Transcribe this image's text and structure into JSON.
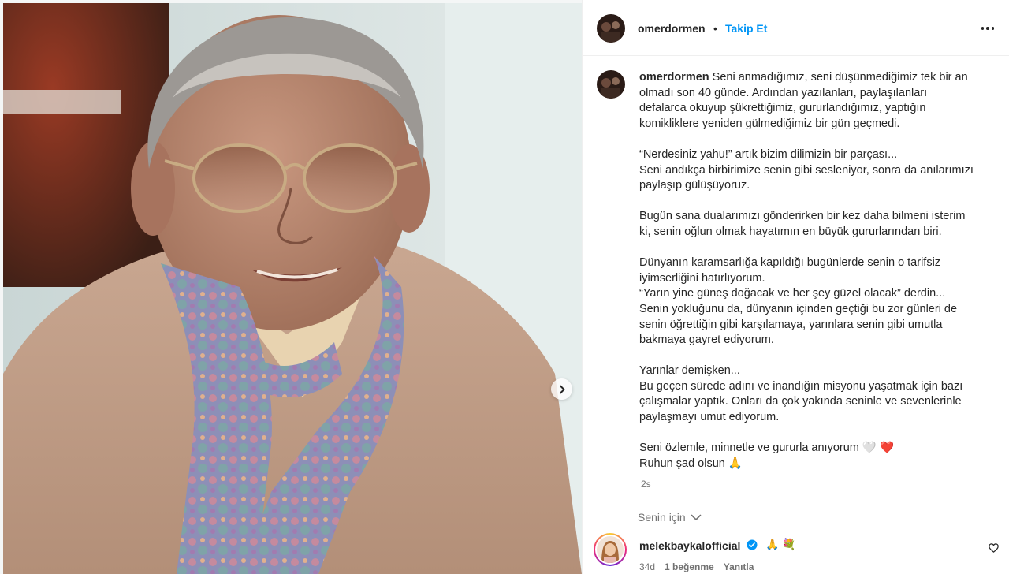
{
  "post": {
    "username": "omerdormen",
    "separator": "•",
    "follow_label": "Takip Et",
    "caption_paragraphs": [
      [
        "Seni anmadığımız, seni düşünmediğimiz tek bir an",
        "olmadı son 40 günde. Ardından yazılanları, paylaşılanları",
        "defalarca okuyup şükrettiğimiz, gururlandığımız, yaptığın",
        "komikliklere yeniden gülmediğimiz bir gün geçmedi."
      ],
      [
        "“Nerdesiniz yahu!” artık bizim dilimizin bir parçası...",
        "Seni andıkça birbirimize senin gibi sesleniyor, sonra da anılarımızı",
        "paylaşıp gülüşüyoruz."
      ],
      [
        "Bugün sana dualarımızı gönderirken bir kez daha bilmeni isterim",
        "ki, senin oğlun olmak hayatımın en büyük gururlarından biri."
      ],
      [
        "Dünyanın karamsarlığa kapıldığı bugünlerde senin o tarifsiz",
        "iyimserliğini hatırlıyorum.",
        "“Yarın yine güneş doğacak ve her şey güzel olacak” derdin...",
        "Senin yokluğunu da, dünyanın içinden geçtiği bu zor günleri de",
        "senin öğrettiğin gibi karşılamaya, yarınlara senin gibi umutla",
        "bakmaya gayret ediyorum."
      ],
      [
        "Yarınlar demişken...",
        "Bu geçen sürede adını ve inandığın misyonu yaşatmak için bazı",
        "çalışmalar yaptık. Onları da çok yakında seninle ve sevenlerinle",
        "paylaşmayı umut ediyorum."
      ],
      [
        "Seni özlemle, minnetle ve gururla anıyorum 🤍 ❤️",
        "Ruhun şad olsun 🙏"
      ]
    ],
    "time_ago": "2s",
    "translate_label": "Senin için"
  },
  "comment": {
    "username": "melekbaykalofficial",
    "text": "🙏 💐",
    "time": "34d",
    "likes": "1 beğenme",
    "reply_label": "Yanıtla"
  },
  "icons": [
    "chevron-right-icon",
    "more-options-icon",
    "verified-badge-icon",
    "heart-icon",
    "chevron-down-icon"
  ],
  "colors": {
    "accent": "#0095f6",
    "muted": "#737373",
    "text": "#262626"
  }
}
